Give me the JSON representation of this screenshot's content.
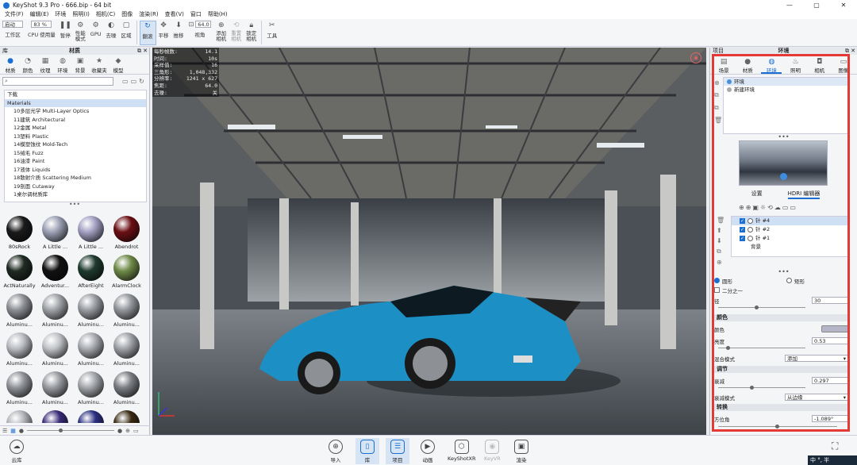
{
  "window": {
    "title": "KeyShot 9.3 Pro  -  666.bip  -  64 bit",
    "controls": [
      "—",
      "▢",
      "✕"
    ]
  },
  "menu": [
    "文件(F)",
    "编辑(E)",
    "环境",
    "照明(I)",
    "相机(C)",
    "图像",
    "渲染(R)",
    "查看(V)",
    "窗口",
    "帮助(H)"
  ],
  "toolbar": {
    "workspace_select": "启动",
    "workspace_label": "工作区",
    "cpu_select": "83 %",
    "cpu_label": "CPU 使用量",
    "pause": "暂停",
    "performance": "性能\n模式",
    "gpu": "GPU",
    "denoise": "去噪",
    "region": "区域",
    "tumble": "翻滚",
    "pan": "平移",
    "dolly": "推移",
    "fov_value": "64.0",
    "fov_label": "视角",
    "add_camera": "添加\n相机",
    "reset_camera": "重置\n相机",
    "lock_camera": "锁定\n相机",
    "tools": "工具"
  },
  "left_panel": {
    "header": "库",
    "title": "材质",
    "tabs": [
      "材质",
      "颜色",
      "纹理",
      "环境",
      "背景",
      "收藏夹",
      "模型"
    ],
    "search_placeholder": "",
    "tree": [
      {
        "label": "下载",
        "level": 0
      },
      {
        "label": "Materials",
        "level": 0,
        "selected": true
      },
      {
        "label": "10多层光学 Multi-Layer Optics",
        "level": 1
      },
      {
        "label": "11建筑 Architectural",
        "level": 1
      },
      {
        "label": "12金属 Metal",
        "level": 1
      },
      {
        "label": "13塑料 Plastic",
        "level": 1
      },
      {
        "label": "14模塑蚀纹 Mold-Tech",
        "level": 1
      },
      {
        "label": "15绒毛 Fuzz",
        "level": 1
      },
      {
        "label": "16油漆 Paint",
        "level": 1
      },
      {
        "label": "17液体 Liquids",
        "level": 1
      },
      {
        "label": "18散射介质 Scattering Medium",
        "level": 1
      },
      {
        "label": "19剖面 Cutaway",
        "level": 1
      },
      {
        "label": "1桌尔调材质库",
        "level": 1
      }
    ],
    "thumbnails": [
      {
        "label": "80sRock",
        "color": "#1a1a1a"
      },
      {
        "label": "A Little ...",
        "color": "#9ba0b4"
      },
      {
        "label": "A Little ...",
        "color": "#a29fc1"
      },
      {
        "label": "Abendrot",
        "color": "#6b0f14"
      },
      {
        "label": "ActNaturally",
        "color": "#1e2a22"
      },
      {
        "label": "Adventur...",
        "color": "#111111"
      },
      {
        "label": "AfterEight",
        "color": "#1f3a2e"
      },
      {
        "label": "AlarmClock",
        "color": "#6f8a48"
      },
      {
        "label": "Aluminu...",
        "color": "#8d9096"
      },
      {
        "label": "Aluminu...",
        "color": "#a0a3a8"
      },
      {
        "label": "Aluminu...",
        "color": "#9a9da2"
      },
      {
        "label": "Aluminu...",
        "color": "#94979c"
      },
      {
        "label": "Aluminu...",
        "color": "#b8bbc0"
      },
      {
        "label": "Aluminu...",
        "color": "#c0c3c7"
      },
      {
        "label": "Aluminu...",
        "color": "#a8abb0"
      },
      {
        "label": "Aluminu...",
        "color": "#9fa2a7"
      },
      {
        "label": "Aluminu...",
        "color": "#8f9297"
      },
      {
        "label": "Aluminu...",
        "color": "#979a9f"
      },
      {
        "label": "Aluminu...",
        "color": "#a3a6ab"
      },
      {
        "label": "Aluminu...",
        "color": "#7b7e83"
      },
      {
        "label": "Aluminu...",
        "color": "#b0b3b8"
      },
      {
        "label": "Amazing ...",
        "color": "#3a2a78"
      },
      {
        "label": "Amazing ...",
        "color": "#2a2f80"
      },
      {
        "label": "Amazon ...",
        "color": "#3a2a12"
      },
      {
        "label": "",
        "color": "#121212"
      },
      {
        "label": "",
        "color": "#b8bbc0"
      },
      {
        "label": "",
        "color": "#145a86"
      },
      {
        "label": "",
        "color": "#a8761c"
      }
    ]
  },
  "stats": [
    {
      "k": "每秒帧数:",
      "v": "14.1"
    },
    {
      "k": "时间:",
      "v": "10s"
    },
    {
      "k": "采样值:",
      "v": "16"
    },
    {
      "k": "三角形:",
      "v": "1,048,332"
    },
    {
      "k": "分辨率:",
      "v": "1241 x 627"
    },
    {
      "k": "焦距:",
      "v": "64.0"
    },
    {
      "k": "去噪:",
      "v": "关"
    }
  ],
  "right_panel": {
    "header_left": "项目",
    "title": "环境",
    "tabs": [
      "场景",
      "材质",
      "环境",
      "照明",
      "相机",
      "图像"
    ],
    "environments": [
      "环境",
      "新建环境"
    ],
    "subtabs": [
      "设置",
      "HDRI 编辑器"
    ],
    "lights": [
      "针 #4",
      "针 #2",
      "针 #1",
      "背景"
    ],
    "shape_circle": "圆形",
    "shape_rect": "矩形",
    "half": "二分之一",
    "radius_label": "径",
    "radius_value": "30",
    "section_color": "颜色",
    "color_label": "颜色",
    "color_swatch": "#b4b6c8",
    "brightness_label": "亮度",
    "brightness_value": "0.53",
    "blend_label": "混合模式",
    "blend_value": "添加",
    "section_adjust": "调节",
    "falloff_label": "衰减",
    "falloff_value": "0.297",
    "falloff_mode_label": "衰减模式",
    "falloff_mode_value": "从边缘",
    "section_transform": "转换",
    "azimuth_label": "方位角",
    "azimuth_value": "-1.089°"
  },
  "bottom_bar": {
    "cloud": "云库",
    "buttons": [
      "导入",
      "库",
      "项目",
      "动画",
      "KeyShotXR",
      "KeyVR",
      "渲染"
    ],
    "ime": "中 °, 半"
  }
}
